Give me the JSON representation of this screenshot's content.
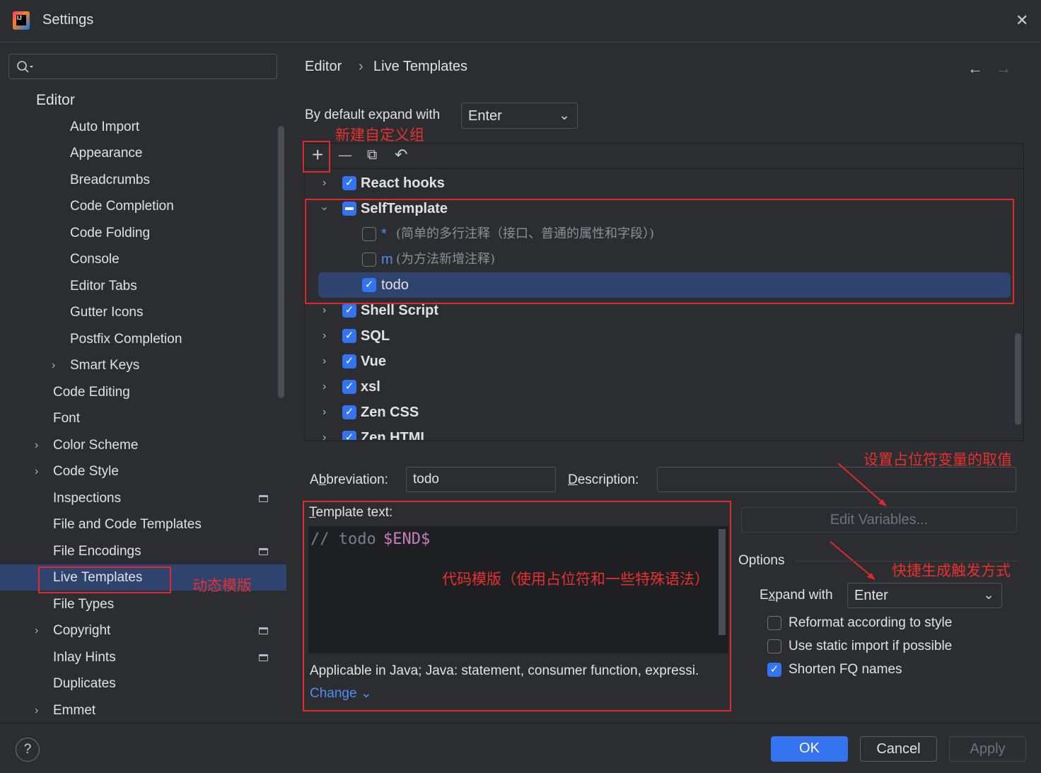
{
  "window": {
    "title": "Settings",
    "close": "✕"
  },
  "breadcrumb": {
    "parent": "Editor",
    "sep": "›",
    "current": "Live Templates",
    "back": "←",
    "forward": "→"
  },
  "sidebar": {
    "items": [
      {
        "label": "Editor",
        "level": 0,
        "chev": false
      },
      {
        "label": "Auto Import",
        "level": 2
      },
      {
        "label": "Appearance",
        "level": 2
      },
      {
        "label": "Breadcrumbs",
        "level": 2
      },
      {
        "label": "Code Completion",
        "level": 2
      },
      {
        "label": "Code Folding",
        "level": 2
      },
      {
        "label": "Console",
        "level": 2
      },
      {
        "label": "Editor Tabs",
        "level": 2
      },
      {
        "label": "Gutter Icons",
        "level": 2
      },
      {
        "label": "Postfix Completion",
        "level": 2
      },
      {
        "label": "Smart Keys",
        "level": 2,
        "chev": true
      },
      {
        "label": "Code Editing",
        "level": 1
      },
      {
        "label": "Font",
        "level": 1
      },
      {
        "label": "Color Scheme",
        "level": 1,
        "chev": true
      },
      {
        "label": "Code Style",
        "level": 1,
        "chev": true
      },
      {
        "label": "Inspections",
        "level": 1,
        "proj": true
      },
      {
        "label": "File and Code Templates",
        "level": 1
      },
      {
        "label": "File Encodings",
        "level": 1,
        "proj": true
      },
      {
        "label": "Live Templates",
        "level": 1,
        "selected": true
      },
      {
        "label": "File Types",
        "level": 1
      },
      {
        "label": "Copyright",
        "level": 1,
        "chev": true,
        "proj": true
      },
      {
        "label": "Inlay Hints",
        "level": 1,
        "proj": true
      },
      {
        "label": "Duplicates",
        "level": 1
      },
      {
        "label": "Emmet",
        "level": 1,
        "chev": true
      }
    ]
  },
  "expand_default": {
    "label": "By default expand with",
    "value": "Enter"
  },
  "toolbar": {
    "add": "+",
    "remove": "—",
    "copy": "⧉",
    "restore": "↶"
  },
  "tree": [
    {
      "label": "React hooks",
      "state": "on",
      "kind": "group",
      "expanded": false
    },
    {
      "label": "SelfTemplate",
      "state": "mix",
      "kind": "group",
      "expanded": true
    },
    {
      "abbr": "*",
      "desc": "(简单的多行注释（接口、普通的属性和字段）)",
      "state": "off",
      "kind": "item"
    },
    {
      "abbr": "m",
      "desc": "(为方法新增注释)",
      "state": "off",
      "kind": "item"
    },
    {
      "abbr": "todo",
      "desc": "",
      "state": "on",
      "kind": "item",
      "selected": true
    },
    {
      "label": "Shell Script",
      "state": "on",
      "kind": "group"
    },
    {
      "label": "SQL",
      "state": "on",
      "kind": "group"
    },
    {
      "label": "Vue",
      "state": "on",
      "kind": "group"
    },
    {
      "label": "xsl",
      "state": "on",
      "kind": "group"
    },
    {
      "label": "Zen CSS",
      "state": "on",
      "kind": "group"
    },
    {
      "label": "Zen HTML",
      "state": "on",
      "kind": "group"
    }
  ],
  "form": {
    "abbr_label": "Abbreviation:",
    "abbr_value": "todo",
    "desc_label": "Description:",
    "desc_value": "",
    "template_label": "Template text:",
    "code_comment": "// todo ",
    "code_var": "$END$",
    "applicable": "Applicable in Java; Java: statement, consumer function, expressi.",
    "change": "Change",
    "edit_vars": "Edit Variables...",
    "options": "Options",
    "expand_label": "Expand with",
    "expand_value": "Enter",
    "opts": [
      {
        "label": "Reformat according to style",
        "checked": false
      },
      {
        "label": "Use static import if possible",
        "checked": false
      },
      {
        "label": "Shorten FQ names",
        "checked": true
      }
    ]
  },
  "annotations": {
    "new_group": "新建自定义组",
    "live_templates": "动态模版",
    "code_template": "代码模版（使用占位符和一些特殊语法）",
    "variables": "设置占位符变量的取值",
    "trigger": "快捷生成触发方式"
  },
  "footer": {
    "help": "?",
    "ok": "OK",
    "cancel": "Cancel",
    "apply": "Apply"
  },
  "colors": {
    "accent": "#3574f0",
    "annotation": "#e0282e",
    "selection": "#2e436e"
  }
}
